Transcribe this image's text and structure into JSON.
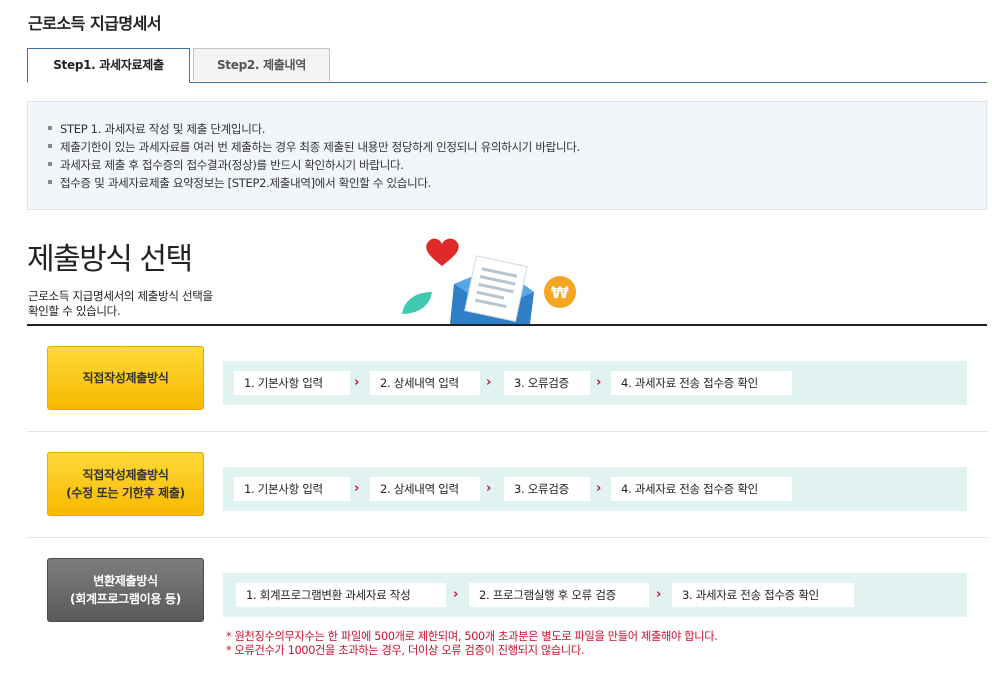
{
  "page_title": "근로소득 지급명세서",
  "tabs": [
    {
      "label": "Step1. 과세자료제출",
      "active": true
    },
    {
      "label": "Step2. 제출내역",
      "active": false
    }
  ],
  "notice": {
    "items": [
      "STEP 1. 과세자료 작성 및 제출 단계입니다.",
      "제출기한이 있는 과세자료를 여러 번 제출하는 경우 최종 제출된 내용만 정당하게 인정되니 유의하시기 바랍니다.",
      "과세자료 제출 후 접수증의 접수결과(정상)를 반드시 확인하시기 바랍니다.",
      "접수증 및 과세자료제출 요약정보는 [STEP2.제출내역]에서 확인할 수 있습니다."
    ]
  },
  "section": {
    "title": "제출방식 선택",
    "desc_line1": "근로소득 지급명세서의 제출방식 선택을",
    "desc_line2": "확인할 수 있습니다."
  },
  "methods": [
    {
      "line1": "직접작성제출방식",
      "line2": "",
      "steps": [
        "1. 기본사항 입력",
        "2. 상세내역 입력",
        "3. 오류검증",
        "4. 과세자료 전송 접수증 확인"
      ]
    },
    {
      "line1": "직접작성제출방식",
      "line2": "(수정 또는 기한후 제출)",
      "steps": [
        "1. 기본사항 입력",
        "2. 상세내역 입력",
        "3. 오류검증",
        "4. 과세자료 전송 접수증 확인"
      ]
    },
    {
      "line1": "변환제출방식",
      "line2": "(회계프로그램이용 등)",
      "steps": [
        "1. 회계프로그램변환 과세자료 작성",
        "2. 프로그램실행 후 오류 검증",
        "3. 과세자료 전송 접수증 확인"
      ]
    }
  ],
  "arrow_glyph": "›",
  "warnings": [
    "* 원천징수의무자수는 한 파일에 500개로 제한되며, 500개 초과분은 별도로 파일을 만들어 제출해야 합니다.",
    "* 오류건수가 1000건을 초과하는 경우, 더이상 오류 검증이 진행되지 않습니다."
  ],
  "hero_icons": {
    "won_symbol": "₩"
  },
  "colors": {
    "accent_blue": "#3d6fa8",
    "step_bg": "#e0f3f0",
    "arrow_red": "#c8102e",
    "yellow": "#f7b900",
    "gray": "#5a5a5a"
  }
}
